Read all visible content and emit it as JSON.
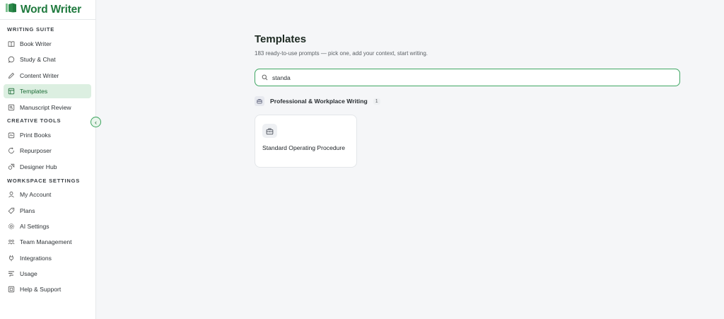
{
  "brand": {
    "name": "Word Writer",
    "color": "#1f7a3e"
  },
  "sidebar": {
    "sections": [
      {
        "title": "WRITING SUITE",
        "items": [
          {
            "label": "Book Writer",
            "icon": "book-open-icon"
          },
          {
            "label": "Study & Chat",
            "icon": "chat-bubble-icon"
          },
          {
            "label": "Content Writer",
            "icon": "pencil-icon"
          },
          {
            "label": "Templates",
            "icon": "template-icon",
            "active": true
          },
          {
            "label": "Manuscript Review",
            "icon": "review-icon"
          }
        ]
      },
      {
        "title": "CREATIVE TOOLS",
        "items": [
          {
            "label": "Print Books",
            "icon": "print-icon"
          },
          {
            "label": "Repurposer",
            "icon": "refresh-icon"
          },
          {
            "label": "Designer Hub",
            "icon": "shapes-icon"
          }
        ]
      },
      {
        "title": "WORKSPACE SETTINGS",
        "items": [
          {
            "label": "My Account",
            "icon": "user-icon"
          },
          {
            "label": "Plans",
            "icon": "tag-icon"
          },
          {
            "label": "AI Settings",
            "icon": "gear-icon"
          },
          {
            "label": "Team Management",
            "icon": "team-icon"
          },
          {
            "label": "Integrations",
            "icon": "plug-icon"
          },
          {
            "label": "Usage",
            "icon": "usage-icon"
          },
          {
            "label": "Help & Support",
            "icon": "help-icon"
          }
        ]
      }
    ],
    "collapse_glyph": "‹"
  },
  "main": {
    "title": "Templates",
    "subtitle": "183 ready-to-use prompts — pick one, add your context, start writing.",
    "search": {
      "value": "standa",
      "placeholder": ""
    },
    "category": {
      "label": "Professional & Workplace Writing",
      "count": "1",
      "icon": "briefcase-icon"
    },
    "cards": [
      {
        "title": "Standard Operating Procedure",
        "icon": "briefcase-icon"
      }
    ]
  },
  "colors": {
    "accent": "#3fa763",
    "active_bg": "#dcefe1"
  }
}
